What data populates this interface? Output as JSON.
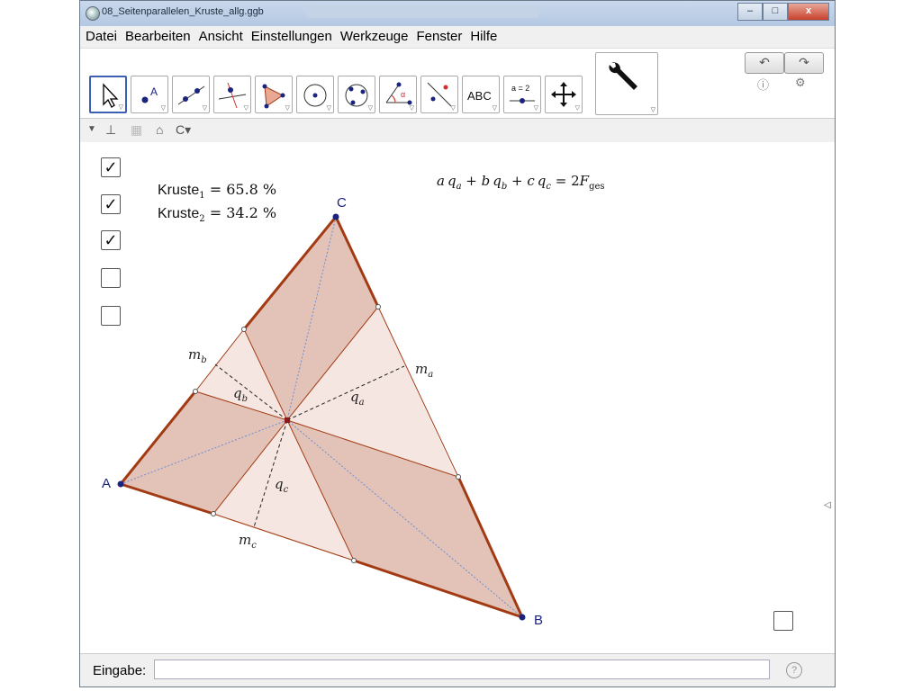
{
  "window": {
    "title": "08_Seitenparallelen_Kruste_allg.ggb"
  },
  "window_buttons": {
    "minimize": "–",
    "maximize": "□",
    "close": "x"
  },
  "menu": [
    "Datei",
    "Bearbeiten",
    "Ansicht",
    "Einstellungen",
    "Werkzeuge",
    "Fenster",
    "Hilfe"
  ],
  "toolbar": {
    "undo": "↶",
    "redo": "↷",
    "tools": [
      "move-tool",
      "point-tool",
      "line-tool",
      "perpendicular-tool",
      "polygon-tool",
      "circle-tool",
      "circle-three-points-tool",
      "angle-tool",
      "reflect-tool",
      "text-tool",
      "slider-tool",
      "move-view-tool"
    ],
    "text_tool_label": "ABC",
    "slider_tool_label": "a = 2"
  },
  "canvas": {
    "texts": {
      "kruste1_name": "Kruste",
      "kruste1_sub": "1",
      "kruste1_value": " = 65.8 %",
      "kruste2_name": "Kruste",
      "kruste2_sub": "2",
      "kruste2_value": " = 34.2 %",
      "formula": "a q_a + b q_b + c q_c = 2F_ges"
    },
    "formula_parts": {
      "a": "a",
      "qa": "q",
      "qa_sub": "a",
      "b": " + b",
      "qb": "q",
      "qb_sub": "b",
      "c": " + c",
      "qc": "q",
      "qc_sub": "c",
      "eq": " = 2",
      "F": "F",
      "F_sub": "ges"
    },
    "points": {
      "A": "A",
      "B": "B",
      "C": "C"
    },
    "labels": {
      "ma": "m",
      "ma_sub": "a",
      "mb": "m",
      "mb_sub": "b",
      "mc": "m",
      "mc_sub": "c",
      "qa": "q",
      "qa_sub": "a",
      "qb": "q",
      "qb_sub": "b",
      "qc": "q",
      "qc_sub": "c"
    },
    "checkboxes": [
      true,
      true,
      true,
      false,
      false
    ],
    "extra_checkbox": false
  },
  "input": {
    "label": "Eingabe:",
    "value": "",
    "help": "?"
  },
  "colors": {
    "crust": "#a23b14",
    "fill_dark": "#e3c3b7",
    "fill_light": "#f5e6e1",
    "point": "#1a237e"
  }
}
